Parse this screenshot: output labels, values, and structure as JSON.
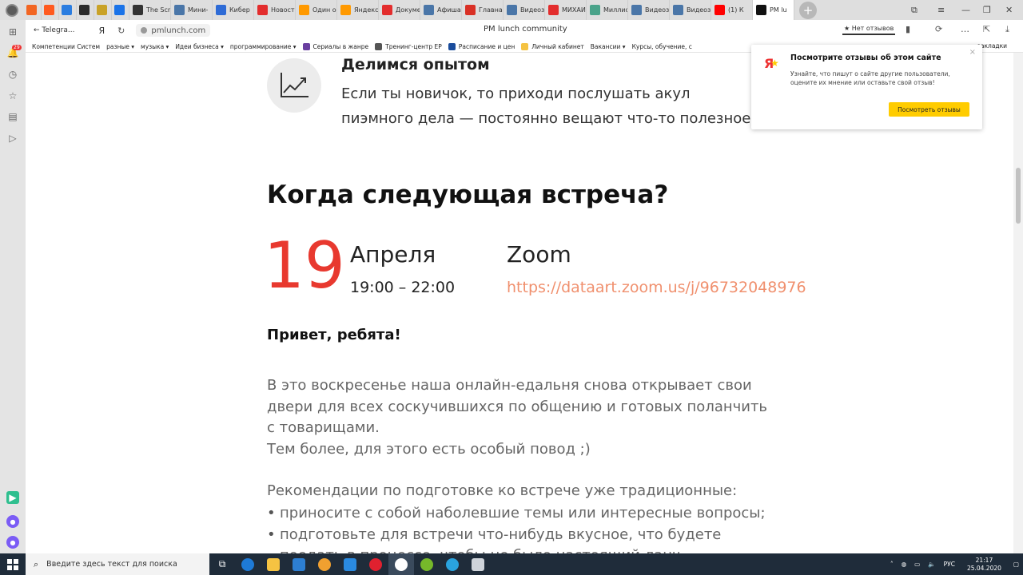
{
  "tabs": [
    {
      "label": "",
      "color": "#f26522"
    },
    {
      "label": "",
      "color": "#ff5a1f"
    },
    {
      "label": "",
      "color": "#2b7de0"
    },
    {
      "label": "",
      "color": "#2b2b2b"
    },
    {
      "label": "",
      "color": "#c9a227"
    },
    {
      "label": "",
      "color": "#1a73e8"
    },
    {
      "label": "The Scr",
      "color": "#333333"
    },
    {
      "label": "Мини-",
      "color": "#4a76a8"
    },
    {
      "label": "Кибер",
      "color": "#2e6bd6"
    },
    {
      "label": "Новост",
      "color": "#e32d2d"
    },
    {
      "label": "Один о",
      "color": "#ff9900"
    },
    {
      "label": "Яндекс",
      "color": "#ff9900"
    },
    {
      "label": "Докуме",
      "color": "#e32d2d"
    },
    {
      "label": "Афиша",
      "color": "#4a76a8"
    },
    {
      "label": "Главная",
      "color": "#d93025"
    },
    {
      "label": "Видеоз",
      "color": "#4a76a8"
    },
    {
      "label": "МИХАИ",
      "color": "#e32d2d"
    },
    {
      "label": "Миллио",
      "color": "#4aa38a"
    },
    {
      "label": "Видеоз",
      "color": "#4a76a8"
    },
    {
      "label": "Видеоз",
      "color": "#4a76a8"
    },
    {
      "label": "(1) К",
      "color": "#ff0000"
    },
    {
      "label": "PM lu",
      "color": "#111111"
    }
  ],
  "addressbar": {
    "back_label": "Telegra...",
    "ya_label": "Я",
    "url": "pmlunch.com",
    "page_title": "PM lunch community",
    "reviews_label": "★ Нет отзывов"
  },
  "bookmarks": {
    "items": [
      "Компетенции Систем",
      "разные ▾",
      "музыка ▾",
      "Идеи бизнеса ▾",
      "программирование ▾",
      "Сериалы в жанре",
      "Тренинг-центр EP",
      "Расписание и цен",
      "Личный кабинет",
      "Вакансии ▾",
      "Курсы, обучение, с"
    ],
    "right_label": "закладки"
  },
  "feature": {
    "title": "Делимся опытом",
    "text": "Если ты новичок, то приходи послушать акул пиэмного дела — постоянно вещают что-то полезное."
  },
  "meeting": {
    "heading": "Когда следующая встреча?",
    "day": "19",
    "month": "Апреля",
    "time": "19:00 – 22:00",
    "platform": "Zoom",
    "link": "https://dataart.zoom.us/j/96732048976"
  },
  "body": {
    "greeting": "Привет, ребята!",
    "para1": "В это воскресенье наша онлайн-едальня снова открывает свои двери для всех соскучившихся по общению и готовых поланчить с товарищами.",
    "para1b": "Тем более, для этого есть особый повод ;)",
    "para2": "Рекомендации по подготовке ко встрече уже традиционные:",
    "bullets": [
      "приносите с собой наболевшие темы или интересные вопросы;",
      "подготовьте для встречи что-нибудь вкусное, что будете поедать в процессе, чтобы не было настоящий ланч"
    ]
  },
  "popup": {
    "logo": "Я",
    "title": "Посмотрите отзывы об этом сайте",
    "text": "Узнайте, что пишут о сайте другие пользователи, оцените их мнение или оставьте свой отзыв!",
    "button": "Посмотреть отзывы",
    "close": "×"
  },
  "taskbar": {
    "search_placeholder": "Введите здесь текст для поиска",
    "lang": "РУС",
    "time": "21:17",
    "date": "25.04.2020"
  },
  "colors": {
    "accent_red": "#e8392f",
    "link": "#f0906e",
    "popup_button": "#ffcc00"
  }
}
